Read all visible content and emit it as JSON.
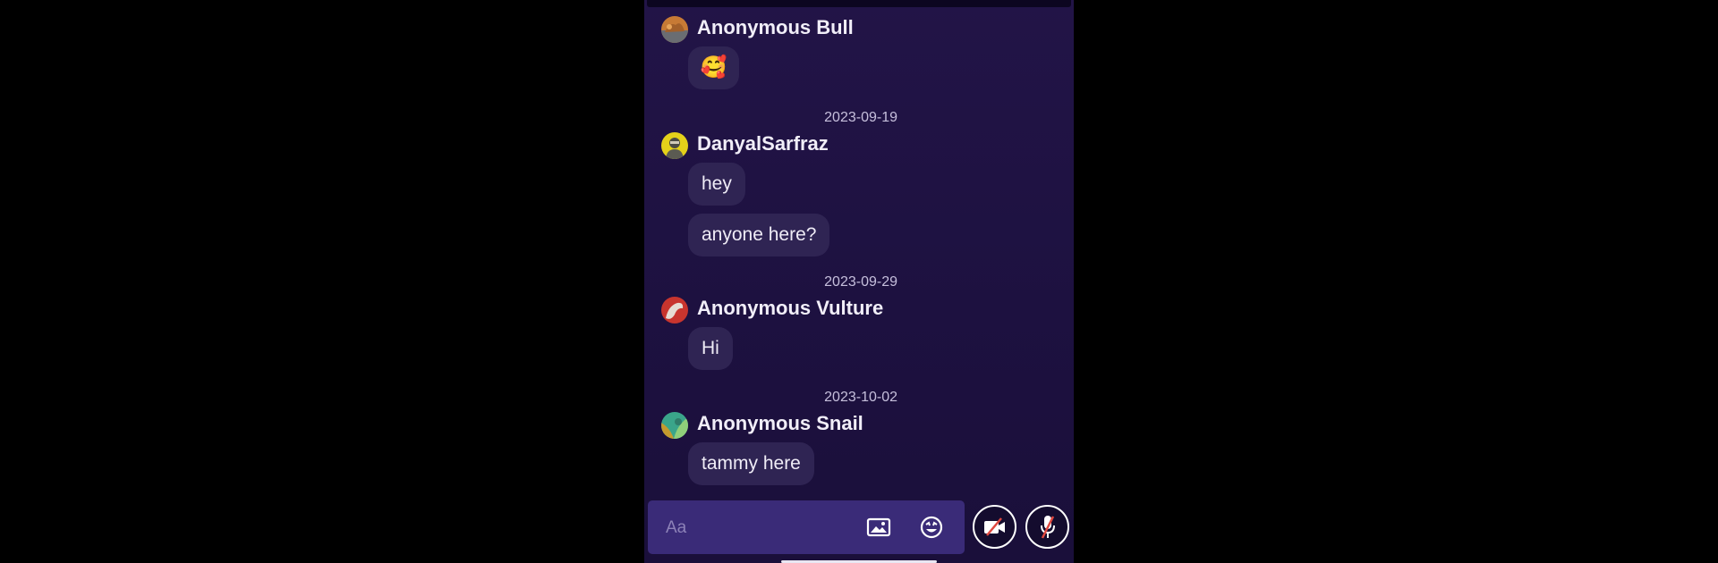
{
  "composer": {
    "placeholder": "Aa",
    "image_icon": "image-icon",
    "emoji_icon": "emoji-icon",
    "video_toggle_icon": "video-off-icon",
    "mic_toggle_icon": "mic-off-icon"
  },
  "messages": [
    {
      "sender": "Anonymous Bull",
      "avatar": "bull-avatar",
      "bubbles": [
        "🥰"
      ]
    },
    {
      "date": "2023-09-19",
      "sender": "DanyalSarfraz",
      "avatar": "user-photo-avatar",
      "bubbles": [
        "hey",
        "anyone here?"
      ]
    },
    {
      "date": "2023-09-29",
      "sender": "Anonymous Vulture",
      "avatar": "vulture-avatar",
      "bubbles": [
        "Hi"
      ]
    },
    {
      "date": "2023-10-02",
      "sender": "Anonymous Snail",
      "avatar": "snail-avatar",
      "bubbles": [
        "tammy here"
      ]
    }
  ],
  "colors": {
    "background": "#1d1140",
    "bubble": "#2f2453",
    "composer": "#3a2b78",
    "muted_slash": "#e0473f"
  }
}
